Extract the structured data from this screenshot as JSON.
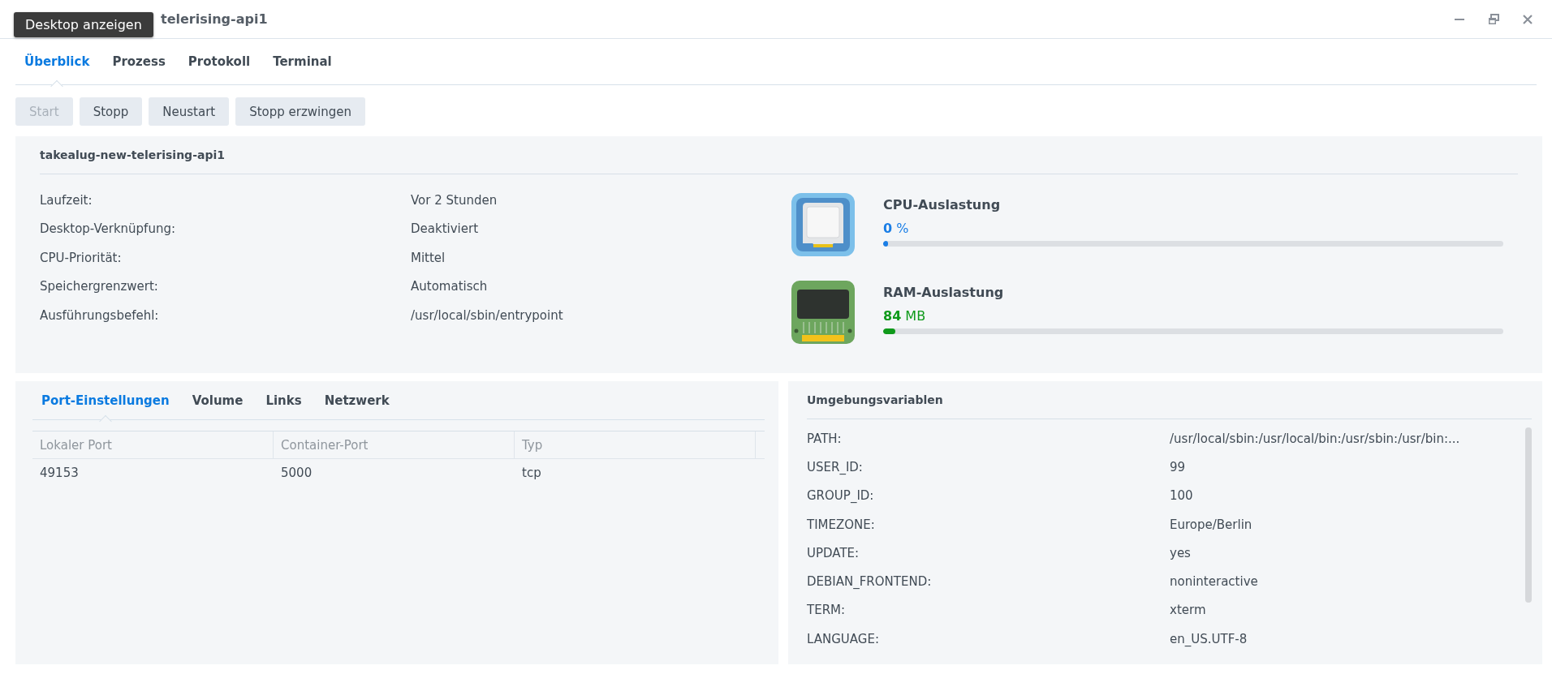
{
  "window": {
    "title": "telerising-api1",
    "tooltip": "Desktop anzeigen"
  },
  "tabs": [
    {
      "label": "Überblick",
      "selected": true
    },
    {
      "label": "Prozess",
      "selected": false
    },
    {
      "label": "Protokoll",
      "selected": false
    },
    {
      "label": "Terminal",
      "selected": false
    }
  ],
  "buttons": [
    {
      "label": "Start",
      "disabled": true
    },
    {
      "label": "Stopp",
      "disabled": false
    },
    {
      "label": "Neustart",
      "disabled": false
    },
    {
      "label": "Stopp erzwingen",
      "disabled": false
    }
  ],
  "overview": {
    "title": "takealug-new-telerising-api1",
    "fields": [
      {
        "label": "Laufzeit:",
        "value": "Vor 2 Stunden"
      },
      {
        "label": "Desktop-Verknüpfung:",
        "value": "Deaktiviert"
      },
      {
        "label": "CPU-Priorität:",
        "value": "Mittel"
      },
      {
        "label": "Speichergrenzwert:",
        "value": "Automatisch"
      },
      {
        "label": "Ausführungsbefehl:",
        "value": "/usr/local/sbin/entrypoint"
      }
    ],
    "meters": [
      {
        "kind": "cpu",
        "title": "CPU-Auslastung",
        "amount": "0",
        "unit": "%",
        "level": 0.008
      },
      {
        "kind": "ram",
        "title": "RAM-Auslastung",
        "amount": "84",
        "unit": "MB",
        "level": 0.02
      }
    ]
  },
  "settings": {
    "tabs": [
      {
        "label": "Port-Einstellungen",
        "selected": true
      },
      {
        "label": "Volume",
        "selected": false
      },
      {
        "label": "Links",
        "selected": false
      },
      {
        "label": "Netzwerk",
        "selected": false
      }
    ],
    "table": {
      "columns": [
        "Lokaler Port",
        "Container-Port",
        "Typ"
      ],
      "rows": [
        [
          "49153",
          "5000",
          "tcp"
        ]
      ]
    }
  },
  "environment": {
    "title": "Umgebungsvariablen",
    "variables": [
      {
        "name": "PATH:",
        "value": "/usr/local/sbin:/usr/local/bin:/usr/sbin:/usr/bin:..."
      },
      {
        "name": "USER_ID:",
        "value": "99"
      },
      {
        "name": "GROUP_ID:",
        "value": "100"
      },
      {
        "name": "TIMEZONE:",
        "value": "Europe/Berlin"
      },
      {
        "name": "UPDATE:",
        "value": "yes"
      },
      {
        "name": "DEBIAN_FRONTEND:",
        "value": "noninteractive"
      },
      {
        "name": "TERM:",
        "value": "xterm"
      },
      {
        "name": "LANGUAGE:",
        "value": "en_US.UTF-8"
      }
    ]
  }
}
